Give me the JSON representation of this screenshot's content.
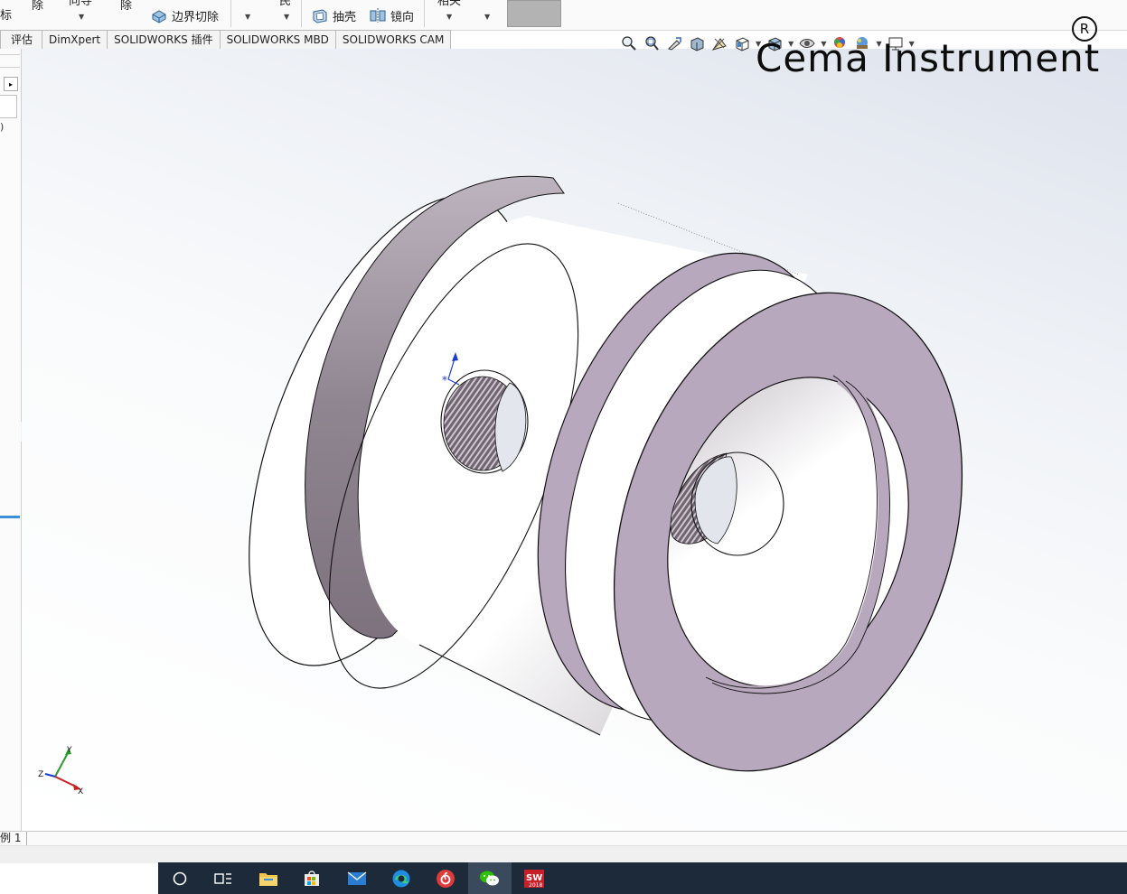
{
  "toolbar": {
    "frag_a": "标",
    "frag_b": "除",
    "frag_c": "向导",
    "frag_d": "除",
    "boundary_cut_label": "边界切除",
    "frag_e": "民",
    "shell_label": "抽壳",
    "mirror_label": "镜向",
    "frag_f": "相关"
  },
  "tabs": [
    "评估",
    "DimXpert",
    "SOLIDWORKS 插件",
    "SOLIDWORKS MBD",
    "SOLIDWORKS CAM"
  ],
  "left_panel": {
    "arrow": "▸",
    "paren_text": ")"
  },
  "heads_up_icons": [
    "zoom-to-fit-icon",
    "zoom-to-area-icon",
    "previous-view-icon",
    "section-view-icon",
    "dynamic-annotation-icon",
    "view-orientation-icon",
    "display-style-icon",
    "hide-show-items-icon",
    "edit-appearance-icon",
    "apply-scene-icon",
    "view-settings-icon"
  ],
  "brand": {
    "name": "Cema Instrument",
    "registered": "R"
  },
  "triad": {
    "x": "X",
    "y": "Y",
    "z": "Z"
  },
  "sketch_origin": {
    "label": "*"
  },
  "status": {
    "model_tab": "例 1"
  },
  "taskbar_items": [
    "cortana-icon",
    "task-view-icon",
    "file-explorer-icon",
    "microsoft-store-icon",
    "mail-icon",
    "edge-icon",
    "netease-music-icon",
    "wechat-icon",
    "solidworks-2018-icon"
  ],
  "colors": {
    "face_lilac": "#b8a8bd",
    "rim_white": "#ffffff",
    "shadow_gray": "#8a7f8a",
    "taskbar": "#1c2a39",
    "accent_blue": "#3c8fd6"
  }
}
